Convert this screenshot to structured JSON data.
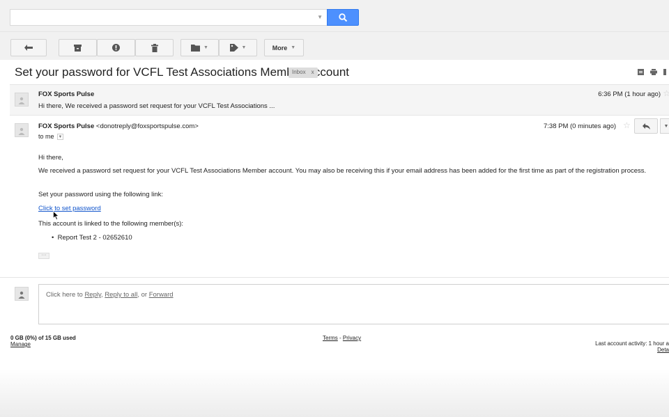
{
  "search": {
    "placeholder": ""
  },
  "toolbar": {
    "buttons": [
      {
        "name": "back-button",
        "icon": "back-arrow-icon"
      },
      {
        "name": "archive-button",
        "icon": "archive-icon"
      },
      {
        "name": "report-spam-button",
        "icon": "exclamation-icon"
      },
      {
        "name": "delete-button",
        "icon": "trash-icon"
      },
      {
        "name": "move-to-button",
        "icon": "folder-icon"
      },
      {
        "name": "labels-button",
        "icon": "tag-icon"
      }
    ],
    "more_label": "More"
  },
  "thread": {
    "subject": "Set your password for VCFL Test Associations Member Account",
    "label": "Inbox",
    "label_close": "x"
  },
  "messages": [
    {
      "sender": "FOX Sports Pulse",
      "snippet": "Hi there, We received a password set request for your VCFL Test Associations ...",
      "date": "6:36 PM (1 hour ago)"
    },
    {
      "sender": "FOX Sports Pulse",
      "email": "<donotreply@foxsportspulse.com>",
      "to": "to me",
      "date": "7:38 PM (0 minutes ago)",
      "body": {
        "greeting": "Hi there,",
        "para1": "We received a password set request for your VCFL Test Associations Member account. You may also be receiving this if your email address has been added for the first time as part of the registration process.",
        "para2": "Set your password using the following link:",
        "link": "Click to set password",
        "para3": "This account is linked to the following member(s):",
        "members": [
          "Report Test 2 - 02652610"
        ],
        "ellipsis": "···"
      }
    }
  ],
  "reply": {
    "prefix": "Click here to ",
    "reply": "Reply",
    "sep1": ", ",
    "reply_all": "Reply to all",
    "sep2": ", or ",
    "forward": "Forward"
  },
  "footer": {
    "storage": "0 GB (0%) of 15 GB used",
    "manage": "Manage",
    "terms": "Terms",
    "dash": " - ",
    "privacy": "Privacy",
    "activity": "Last account activity: 1 hour a",
    "details": "Deta"
  },
  "colors": {
    "accent": "#4d90fe",
    "link": "#1155cc",
    "label_bg": "#dddddd"
  }
}
